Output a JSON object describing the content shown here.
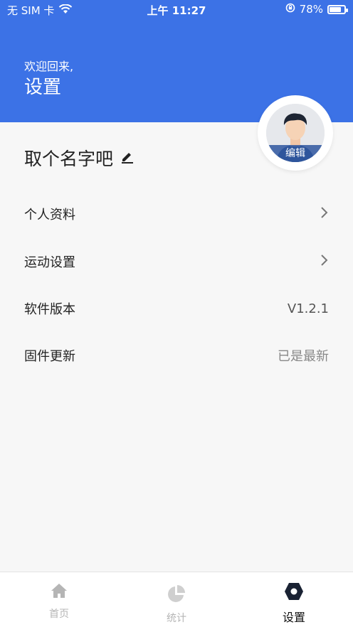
{
  "status_bar": {
    "carrier": "无 SIM 卡",
    "time": "上午 11:27",
    "battery_percent": "78%",
    "battery_level": 0.78
  },
  "header": {
    "welcome": "欢迎回来,",
    "title": "设置"
  },
  "profile": {
    "avatar_edit_label": "编辑",
    "name": "取个名字吧"
  },
  "menu": [
    {
      "label": "个人资料",
      "value": "",
      "has_chevron": true
    },
    {
      "label": "运动设置",
      "value": "",
      "has_chevron": true
    },
    {
      "label": "软件版本",
      "value": "V1.2.1",
      "has_chevron": false
    },
    {
      "label": "固件更新",
      "value": "已是最新",
      "has_chevron": false
    }
  ],
  "tabs": [
    {
      "label": "首页",
      "icon": "home-icon"
    },
    {
      "label": "统计",
      "icon": "pie-chart-icon"
    },
    {
      "label": "设置",
      "icon": "settings-hexagon-icon",
      "active": true
    }
  ],
  "colors": {
    "header_blue": "#3c72e6",
    "background": "#f7f7f7",
    "tab_inactive": "#b5b5b5",
    "tab_active": "#111111"
  }
}
